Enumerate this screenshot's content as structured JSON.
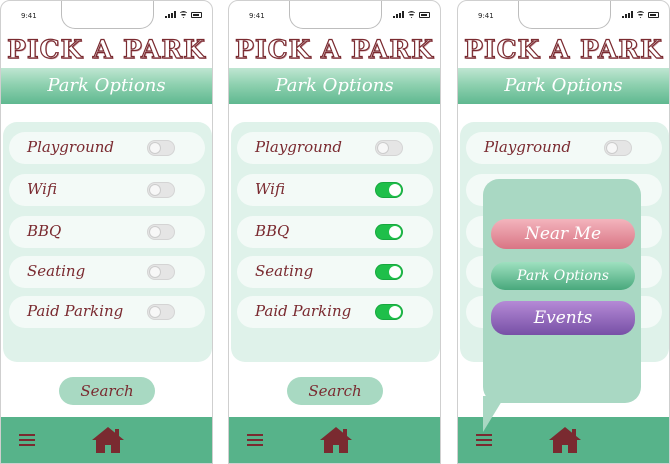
{
  "status": {
    "time": "9:41"
  },
  "app": {
    "title": "PICK A PARK",
    "section_title": "Park Options"
  },
  "options": [
    {
      "label": "Playground"
    },
    {
      "label": "Wifi"
    },
    {
      "label": "BBQ"
    },
    {
      "label": "Seating"
    },
    {
      "label": "Paid Parking"
    }
  ],
  "screens": [
    {
      "toggles": [
        false,
        false,
        false,
        false,
        false
      ]
    },
    {
      "toggles": [
        false,
        true,
        true,
        true,
        true
      ]
    },
    {
      "toggles": [
        false
      ]
    }
  ],
  "search_label": "Search",
  "menu": {
    "near_me": "Near Me",
    "park_options": "Park Options",
    "events": "Events"
  },
  "colors": {
    "accent_green": "#57b38a",
    "text_maroon": "#7a2a30",
    "toggle_on": "#1fbf4a"
  }
}
